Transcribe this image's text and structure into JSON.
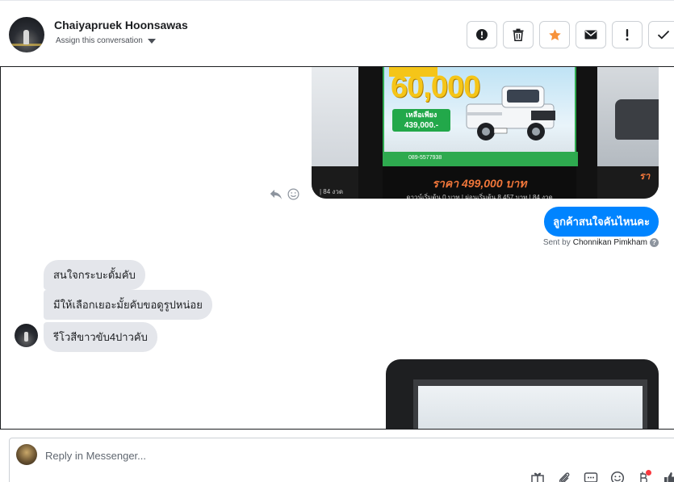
{
  "header": {
    "contact_name": "Chaiyapruek Hoonsawas",
    "assign_label": "Assign this conversation",
    "actions": [
      {
        "name": "spam-button",
        "icon": "exclamation-circle-icon"
      },
      {
        "name": "delete-button",
        "icon": "trash-icon"
      },
      {
        "name": "star-button",
        "icon": "star-icon",
        "color": "#f7923a"
      },
      {
        "name": "mark-unread-button",
        "icon": "envelope-icon"
      },
      {
        "name": "follow-up-button",
        "icon": "exclamation-icon"
      },
      {
        "name": "done-button",
        "icon": "checkmark-icon"
      }
    ]
  },
  "carousel": {
    "promo_amount": "60,000",
    "remaining_label": "เหลือเพียง",
    "remaining_price": "439,000.-",
    "phone": "089-5577938",
    "price_text": "ราคา 499,000 บาท",
    "fine_print": "ดาวน์เริ่มต้น 0 บาท | ผ่อนเริ่มต้น 8,457 บาท | 84 งวด",
    "left_fine": "| 84 งวด",
    "right_price": "รา"
  },
  "messages": {
    "outgoing": "ลูกค้าสนใจคันไหนคะ",
    "sent_by_prefix": "Sent by",
    "sent_by_name": "Chonnikan Pimkham",
    "help": "?",
    "incoming": [
      "สนใจกระบะดั้มคับ",
      "มีให้เลือกเยอะมั้ยคับขอดูรูปหน่อย",
      "รีโวสีขาวขับ4ปาวคับ"
    ]
  },
  "composer": {
    "placeholder": "Reply in Messenger...",
    "tools": [
      "gift-icon",
      "paperclip-icon",
      "saved-reply-icon",
      "emoji-icon",
      "payment-icon",
      "thumbs-up-icon"
    ]
  },
  "colors": {
    "brand_blue": "#0084ff",
    "incoming_bg": "#e4e6eb",
    "star": "#f7923a",
    "notification": "#fa383e"
  }
}
